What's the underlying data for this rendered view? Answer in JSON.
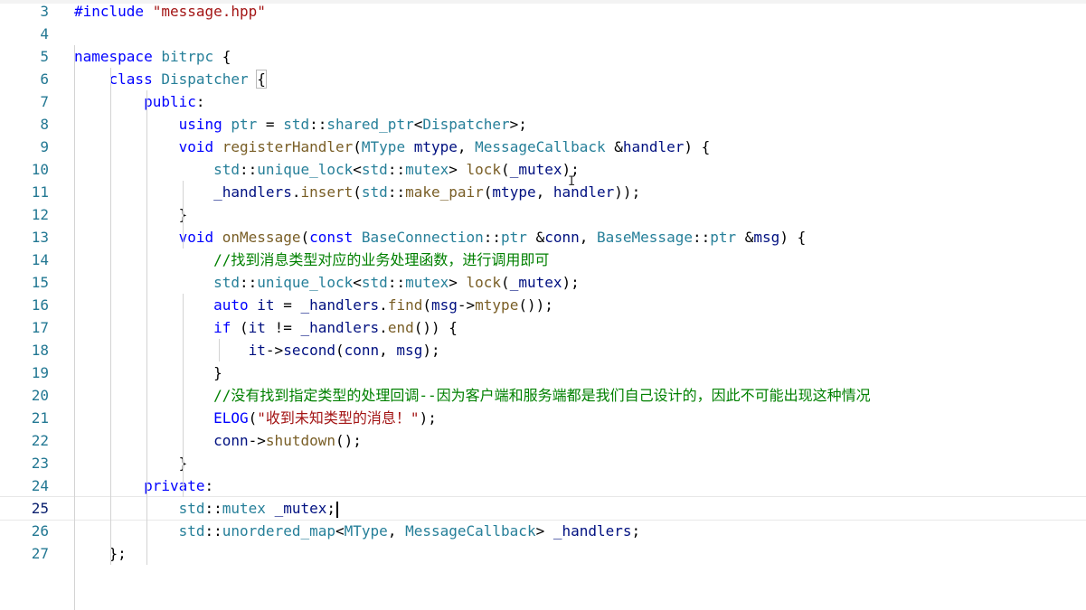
{
  "editor": {
    "lines": [
      {
        "n": "3",
        "tokens": [
          {
            "t": "#include ",
            "c": "pp"
          },
          {
            "t": "\"message.hpp\"",
            "c": "str"
          }
        ]
      },
      {
        "n": "4",
        "tokens": []
      },
      {
        "n": "5",
        "tokens": [
          {
            "t": "namespace ",
            "c": "kw"
          },
          {
            "t": "bitrpc",
            "c": "ty"
          },
          {
            "t": " {",
            "c": ""
          }
        ]
      },
      {
        "n": "6",
        "tokens": [
          {
            "t": "    "
          },
          {
            "t": "class ",
            "c": "kw"
          },
          {
            "t": "Dispatcher",
            "c": "ty"
          },
          {
            "t": " "
          },
          {
            "t": "{",
            "c": "",
            "hl": true
          }
        ]
      },
      {
        "n": "7",
        "tokens": [
          {
            "t": "        "
          },
          {
            "t": "public",
            "c": "kw"
          },
          {
            "t": ":"
          }
        ]
      },
      {
        "n": "8",
        "tokens": [
          {
            "t": "            "
          },
          {
            "t": "using ",
            "c": "kw"
          },
          {
            "t": "ptr",
            "c": "ty"
          },
          {
            "t": " = "
          },
          {
            "t": "std",
            "c": "ty"
          },
          {
            "t": "::"
          },
          {
            "t": "shared_ptr",
            "c": "ty"
          },
          {
            "t": "<"
          },
          {
            "t": "Dispatcher",
            "c": "ty"
          },
          {
            "t": ">;"
          }
        ]
      },
      {
        "n": "9",
        "tokens": [
          {
            "t": "            "
          },
          {
            "t": "void ",
            "c": "kw"
          },
          {
            "t": "registerHandler",
            "c": "fn"
          },
          {
            "t": "("
          },
          {
            "t": "MType",
            "c": "ty"
          },
          {
            "t": " "
          },
          {
            "t": "mtype",
            "c": "var"
          },
          {
            "t": ", "
          },
          {
            "t": "MessageCallback",
            "c": "ty"
          },
          {
            "t": " &"
          },
          {
            "t": "handler",
            "c": "var"
          },
          {
            "t": ") {"
          }
        ]
      },
      {
        "n": "10",
        "tokens": [
          {
            "t": "                "
          },
          {
            "t": "std",
            "c": "ty"
          },
          {
            "t": "::"
          },
          {
            "t": "unique_lock",
            "c": "ty"
          },
          {
            "t": "<"
          },
          {
            "t": "std",
            "c": "ty"
          },
          {
            "t": "::"
          },
          {
            "t": "mutex",
            "c": "ty"
          },
          {
            "t": "> "
          },
          {
            "t": "lock",
            "c": "fn"
          },
          {
            "t": "("
          },
          {
            "t": "_mutex",
            "c": "var"
          },
          {
            "t": ");"
          }
        ]
      },
      {
        "n": "11",
        "tokens": [
          {
            "t": "                "
          },
          {
            "t": "_handlers",
            "c": "var"
          },
          {
            "t": "."
          },
          {
            "t": "insert",
            "c": "fn"
          },
          {
            "t": "("
          },
          {
            "t": "std",
            "c": "ty"
          },
          {
            "t": "::"
          },
          {
            "t": "make_pair",
            "c": "fn"
          },
          {
            "t": "("
          },
          {
            "t": "mtype",
            "c": "var"
          },
          {
            "t": ", "
          },
          {
            "t": "handler",
            "c": "var"
          },
          {
            "t": "));"
          }
        ]
      },
      {
        "n": "12",
        "tokens": [
          {
            "t": "            }"
          }
        ]
      },
      {
        "n": "13",
        "tokens": [
          {
            "t": "            "
          },
          {
            "t": "void ",
            "c": "kw"
          },
          {
            "t": "onMessage",
            "c": "fn"
          },
          {
            "t": "("
          },
          {
            "t": "const ",
            "c": "kw"
          },
          {
            "t": "BaseConnection",
            "c": "ty"
          },
          {
            "t": "::"
          },
          {
            "t": "ptr",
            "c": "ty"
          },
          {
            "t": " &"
          },
          {
            "t": "conn",
            "c": "var"
          },
          {
            "t": ", "
          },
          {
            "t": "BaseMessage",
            "c": "ty"
          },
          {
            "t": "::"
          },
          {
            "t": "ptr",
            "c": "ty"
          },
          {
            "t": " &"
          },
          {
            "t": "msg",
            "c": "var"
          },
          {
            "t": ") {"
          }
        ]
      },
      {
        "n": "14",
        "tokens": [
          {
            "t": "                "
          },
          {
            "t": "//找到消息类型对应的业务处理函数，进行调用即可",
            "c": "cm"
          }
        ]
      },
      {
        "n": "15",
        "tokens": [
          {
            "t": "                "
          },
          {
            "t": "std",
            "c": "ty"
          },
          {
            "t": "::"
          },
          {
            "t": "unique_lock",
            "c": "ty"
          },
          {
            "t": "<"
          },
          {
            "t": "std",
            "c": "ty"
          },
          {
            "t": "::"
          },
          {
            "t": "mutex",
            "c": "ty"
          },
          {
            "t": "> "
          },
          {
            "t": "lock",
            "c": "fn"
          },
          {
            "t": "("
          },
          {
            "t": "_mutex",
            "c": "var"
          },
          {
            "t": ");"
          }
        ]
      },
      {
        "n": "16",
        "tokens": [
          {
            "t": "                "
          },
          {
            "t": "auto ",
            "c": "kw"
          },
          {
            "t": "it",
            "c": "var"
          },
          {
            "t": " = "
          },
          {
            "t": "_handlers",
            "c": "var"
          },
          {
            "t": "."
          },
          {
            "t": "find",
            "c": "fn"
          },
          {
            "t": "("
          },
          {
            "t": "msg",
            "c": "var"
          },
          {
            "t": "->"
          },
          {
            "t": "mtype",
            "c": "fn"
          },
          {
            "t": "());"
          }
        ]
      },
      {
        "n": "17",
        "tokens": [
          {
            "t": "                "
          },
          {
            "t": "if ",
            "c": "kw"
          },
          {
            "t": "("
          },
          {
            "t": "it",
            "c": "var"
          },
          {
            "t": " != "
          },
          {
            "t": "_handlers",
            "c": "var"
          },
          {
            "t": "."
          },
          {
            "t": "end",
            "c": "fn"
          },
          {
            "t": "()) {"
          }
        ]
      },
      {
        "n": "18",
        "tokens": [
          {
            "t": "                    "
          },
          {
            "t": "it",
            "c": "var"
          },
          {
            "t": "->"
          },
          {
            "t": "second",
            "c": "var"
          },
          {
            "t": "("
          },
          {
            "t": "conn",
            "c": "var"
          },
          {
            "t": ", "
          },
          {
            "t": "msg",
            "c": "var"
          },
          {
            "t": ");"
          }
        ]
      },
      {
        "n": "19",
        "tokens": [
          {
            "t": "                }"
          }
        ]
      },
      {
        "n": "20",
        "tokens": [
          {
            "t": "                "
          },
          {
            "t": "//没有找到指定类型的处理回调--因为客户端和服务端都是我们自己设计的，因此不可能出现这种情况",
            "c": "cm"
          }
        ]
      },
      {
        "n": "21",
        "tokens": [
          {
            "t": "                "
          },
          {
            "t": "ELOG",
            "c": "kw"
          },
          {
            "t": "("
          },
          {
            "t": "\"收到未知类型的消息！\"",
            "c": "str"
          },
          {
            "t": ");"
          }
        ]
      },
      {
        "n": "22",
        "tokens": [
          {
            "t": "                "
          },
          {
            "t": "conn",
            "c": "var"
          },
          {
            "t": "->"
          },
          {
            "t": "shutdown",
            "c": "fn"
          },
          {
            "t": "();"
          }
        ]
      },
      {
        "n": "23",
        "tokens": [
          {
            "t": "            }"
          }
        ]
      },
      {
        "n": "24",
        "tokens": [
          {
            "t": "        "
          },
          {
            "t": "private",
            "c": "kw"
          },
          {
            "t": ":"
          }
        ]
      },
      {
        "n": "25",
        "tokens": [
          {
            "t": "            "
          },
          {
            "t": "std",
            "c": "ty"
          },
          {
            "t": "::"
          },
          {
            "t": "mutex",
            "c": "ty"
          },
          {
            "t": " "
          },
          {
            "t": "_mutex",
            "c": "var"
          },
          {
            "t": ";"
          }
        ],
        "current": true
      },
      {
        "n": "26",
        "tokens": [
          {
            "t": "            "
          },
          {
            "t": "std",
            "c": "ty"
          },
          {
            "t": "::"
          },
          {
            "t": "unordered_map",
            "c": "ty"
          },
          {
            "t": "<"
          },
          {
            "t": "MType",
            "c": "ty"
          },
          {
            "t": ", "
          },
          {
            "t": "MessageCallback",
            "c": "ty"
          },
          {
            "t": "> "
          },
          {
            "t": "_handlers",
            "c": "var"
          },
          {
            "t": ";"
          }
        ]
      },
      {
        "n": "27",
        "tokens": [
          {
            "t": "    };"
          }
        ]
      }
    ]
  }
}
